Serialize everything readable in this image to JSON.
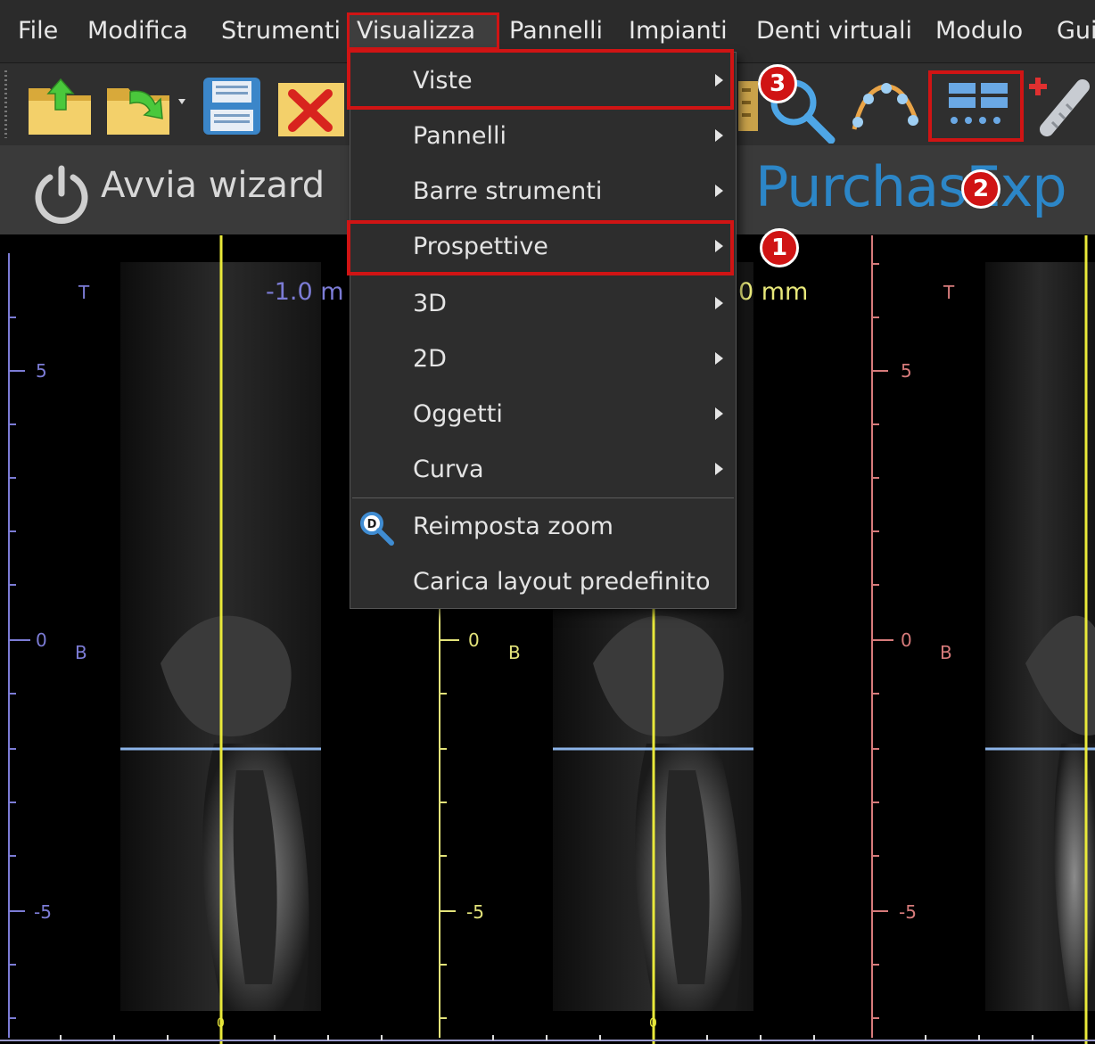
{
  "menubar": {
    "items": [
      "File",
      "Modifica",
      "Strumenti",
      "Visualizza",
      "Pannelli",
      "Impianti",
      "Denti virtuali",
      "Modulo",
      "Gui"
    ]
  },
  "toolbar": {
    "icons": [
      "open-folder-icon",
      "import-folder-icon",
      "save-disk-icon",
      "close-x-icon",
      "magnifier-icon",
      "curve-icon",
      "layout-panels-icon",
      "add-implant-icon"
    ]
  },
  "wizard": {
    "label": "Avvia wizard"
  },
  "banner": {
    "text": "PurchasExp"
  },
  "dropdown": {
    "items": [
      {
        "label": "Viste",
        "submenu": true
      },
      {
        "label": "Pannelli",
        "submenu": true
      },
      {
        "label": "Barre strumenti",
        "submenu": true
      },
      {
        "label": "Prospettive",
        "submenu": true
      },
      {
        "label": "3D",
        "submenu": true
      },
      {
        "label": "2D",
        "submenu": true
      },
      {
        "label": "Oggetti",
        "submenu": true
      },
      {
        "label": "Curva",
        "submenu": true
      },
      {
        "label": "Reimposta zoom",
        "submenu": false
      },
      {
        "label": "Carica layout predefinito",
        "submenu": false
      }
    ]
  },
  "badges": [
    "1",
    "2",
    "3"
  ],
  "viewports": [
    {
      "top": "T",
      "bottom": "B",
      "ticks": [
        "5",
        "0",
        "-5"
      ],
      "zero": "0",
      "mm": "-1.0 m",
      "color": "#7c7cd6"
    },
    {
      "top": "",
      "bottom": "B",
      "ticks": [
        "0",
        "-5"
      ],
      "zero": "0",
      "mm": "0 mm",
      "color": "#e3e37a"
    },
    {
      "top": "T",
      "bottom": "B",
      "ticks": [
        "5",
        "0",
        "-5"
      ],
      "zero": "",
      "mm": "",
      "color": "#d77b7b"
    }
  ]
}
